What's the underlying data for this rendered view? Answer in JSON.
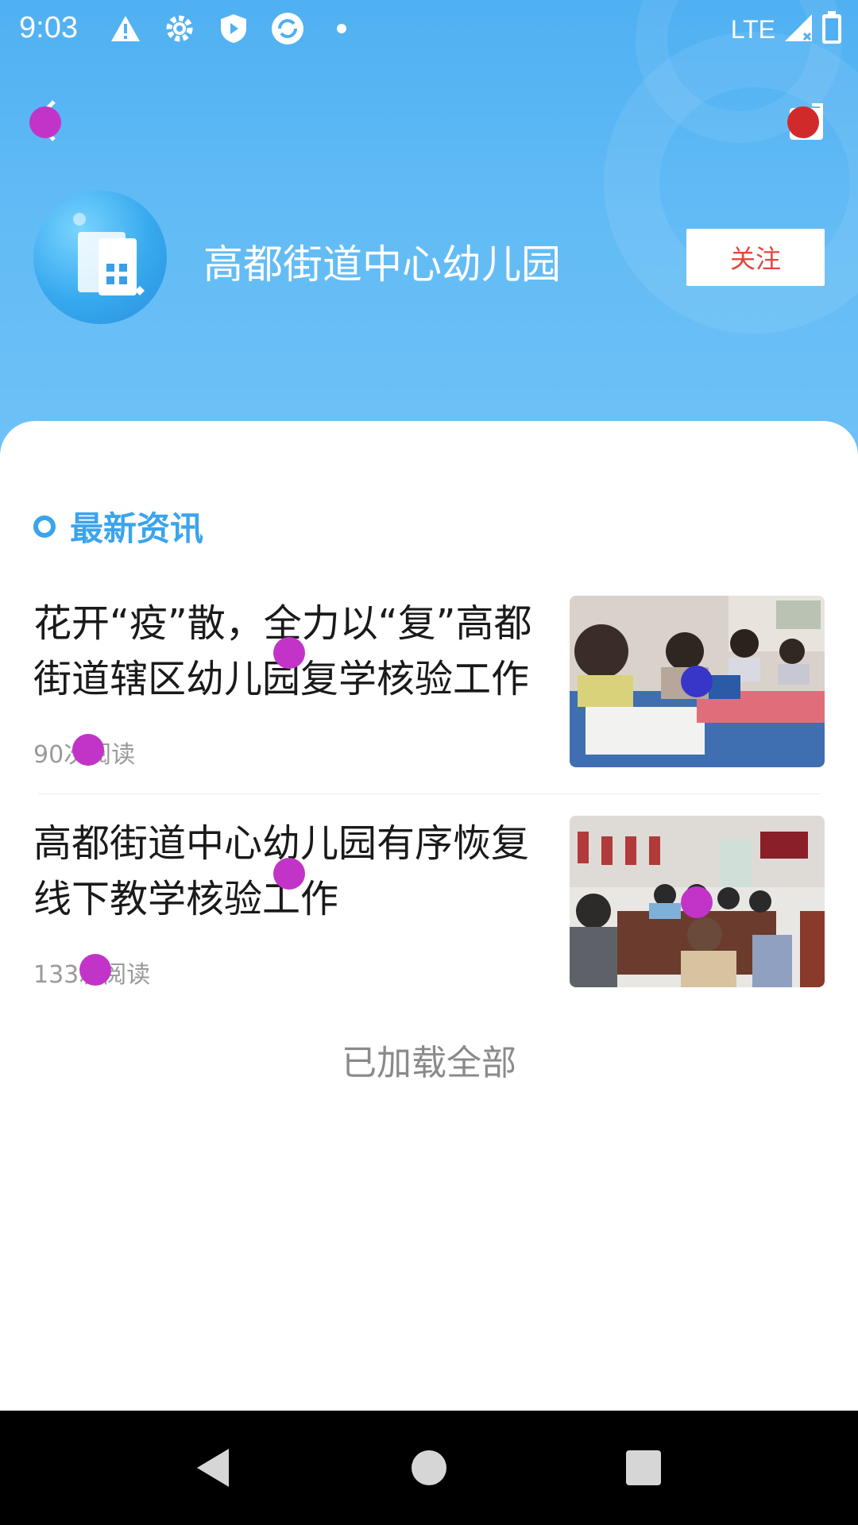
{
  "status_bar": {
    "time": "9:03",
    "network": "LTE",
    "icons": [
      "warning-icon",
      "gear-icon",
      "shield-icon",
      "sync-icon",
      "dot-icon",
      "signal-icon",
      "battery-icon"
    ]
  },
  "header": {
    "org_name": "高都街道中心幼儿园",
    "follow_label": "关注",
    "back_icon": "back-icon",
    "share_icon": "share-icon"
  },
  "section": {
    "title": "最新资讯"
  },
  "news": [
    {
      "title": "花开“疫”散，全力以“复”高都街道辖区幼儿园复学核验工作",
      "meta": "90次阅读"
    },
    {
      "title": "高都街道中心幼儿园有序恢复线下教学核验工作",
      "meta": "133次阅读"
    }
  ],
  "footer": {
    "load_all": "已加载全部"
  },
  "colors": {
    "accent": "#3ba4ec",
    "follow_text": "#e2463c",
    "header_bg": "#5cb8f4"
  },
  "nav": {
    "back": "nav-back-icon",
    "home": "nav-home-icon",
    "recents": "nav-recents-icon"
  }
}
